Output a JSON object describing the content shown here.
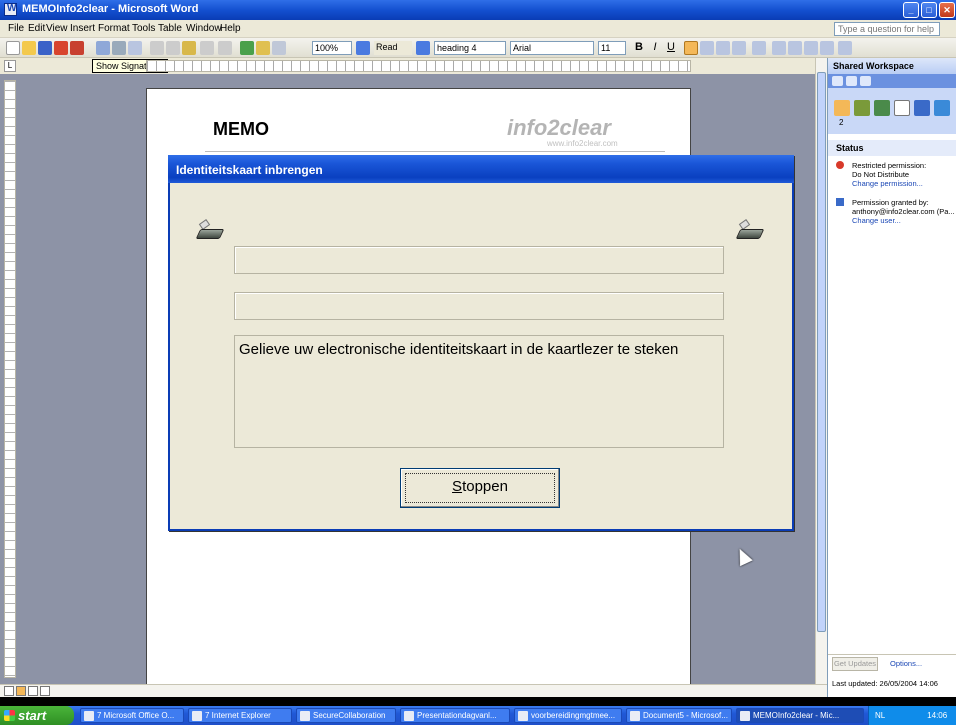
{
  "window": {
    "title": "MEMOInfo2clear - Microsoft Word"
  },
  "menu": [
    "File",
    "Edit",
    "View",
    "Insert",
    "Format",
    "Tools",
    "Table",
    "Window",
    "Help"
  ],
  "help_placeholder": "Type a question for help",
  "toolbar": {
    "zoom": "100%",
    "read_label": "Read",
    "style": "heading 4",
    "font": "Arial",
    "font_size": "11"
  },
  "tooltip": "Show Signatures",
  "document": {
    "memo_title": "MEMO",
    "logo_text": "info2clear",
    "logo_url": "www.info2clear.com"
  },
  "dialog": {
    "title": "Identiteitskaart inbrengen",
    "field1": "",
    "field2": "",
    "message": "Gelieve uw electronische identiteitskaart in de kaartlezer te steken",
    "stop_button": "Stoppen"
  },
  "taskpane": {
    "title": "Shared Workspace",
    "status_header": "Status",
    "tab_badge": "2",
    "entries": [
      {
        "line1": "Restricted permission:",
        "line2": "Do Not Distribute",
        "link": "Change permission..."
      },
      {
        "line1": "Permission granted by:",
        "line2": "anthony@info2clear.com (Pa...",
        "link": "Change user..."
      }
    ],
    "get_updates": "Get Updates",
    "options": "Options...",
    "last_updated": "Last updated: 26/05/2004 14:06"
  },
  "taskbar": {
    "start": "start",
    "items": [
      "7 Microsoft Office O...",
      "7 Internet Explorer",
      "SecureCollaboration",
      "Presentationdagvanl...",
      "voorbereidingmgtmee...",
      "Document5 - Microsof...",
      "MEMOInfo2clear - Mic..."
    ],
    "tray_lang": "NL",
    "clock": "14:06"
  },
  "colors": {
    "titlebar": "#1450d0",
    "dialog_bg": "#ece9d8",
    "doc_bg": "#8d93a6"
  }
}
